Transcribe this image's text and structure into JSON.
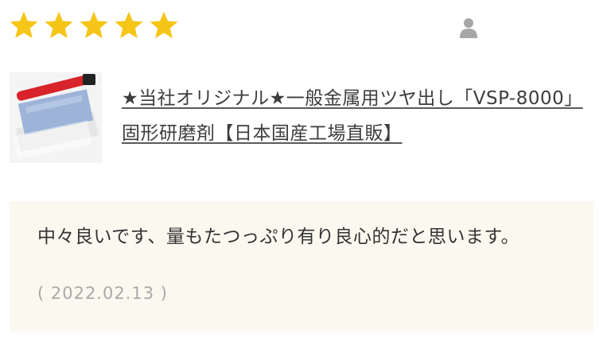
{
  "rating": {
    "value": 5,
    "max": 5,
    "star_color": "#f5c518"
  },
  "reviewer": {
    "icon": "user-icon",
    "icon_color": "#a6a6a6"
  },
  "product": {
    "title": "★当社オリジナル★一般金属用ツヤ出し「VSP-8000」固形研磨剤【日本国産工場直販】",
    "thumbnail": "product-photo"
  },
  "review": {
    "text": "中々良いです、量もたつっぷり有り良心的だと思います。",
    "date": "( 2022.02.13 )",
    "background": "#fbf8ef"
  }
}
